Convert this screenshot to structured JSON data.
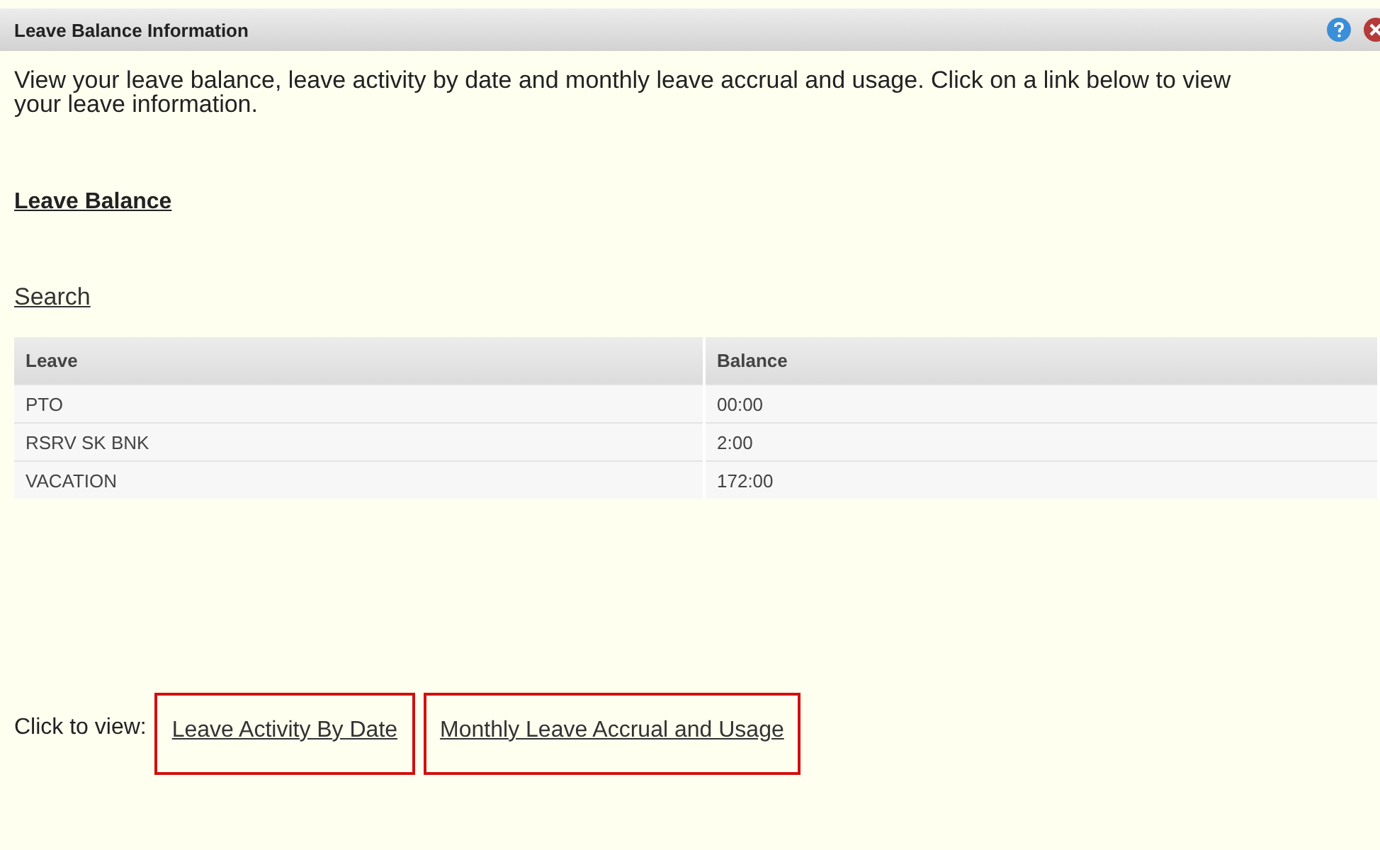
{
  "window": {
    "title": "Leave Balance Information"
  },
  "intro": "View your leave balance, leave activity by date and monthly leave accrual and usage. Click on a link below to view your leave information.",
  "section_heading": "Leave Balance",
  "search_link": "Search",
  "table": {
    "columns": [
      "Leave",
      "Balance"
    ],
    "rows": [
      [
        "PTO",
        "00:00"
      ],
      [
        "RSRV SK BNK",
        "2:00"
      ],
      [
        "VACATION",
        "172:00"
      ]
    ]
  },
  "footer": {
    "label": "Click to view:",
    "links": [
      {
        "text": "Leave Activity By Date",
        "highlighted": true
      },
      {
        "text": "Monthly Leave Accrual and Usage",
        "highlighted": true
      }
    ]
  }
}
